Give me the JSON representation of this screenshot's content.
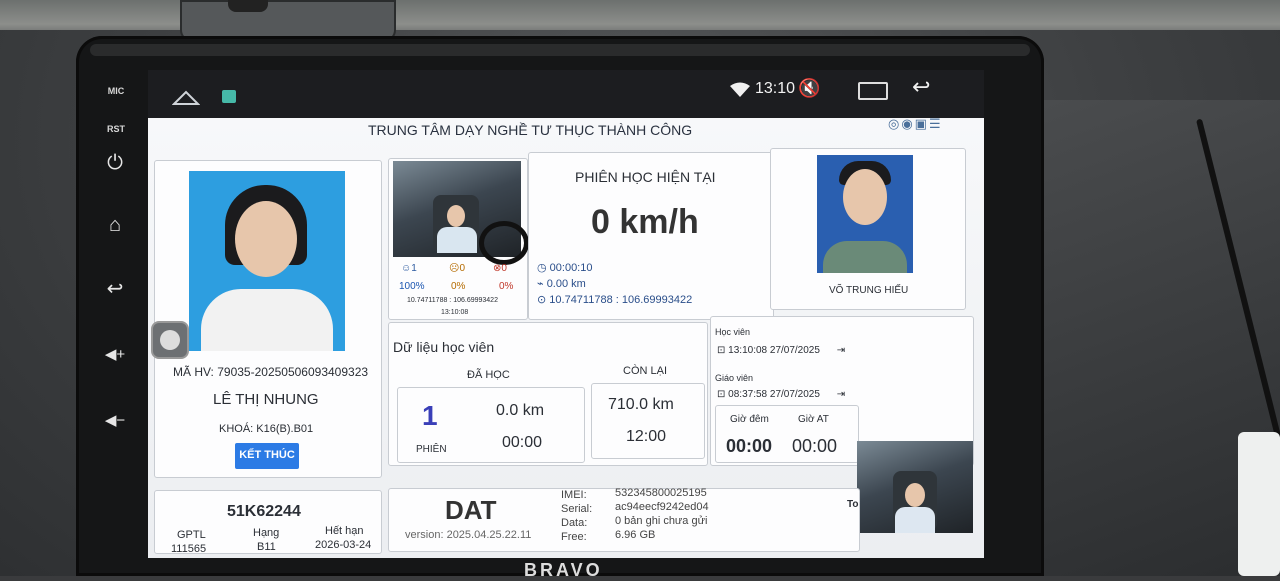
{
  "statusbar": {
    "time": "13:10",
    "icons": [
      "home-outline-icon",
      "app-thumb-icon",
      "wifi-icon",
      "mute-icon",
      "recents-icon",
      "back-icon"
    ]
  },
  "side_buttons": {
    "mic": "MIC",
    "rst": "RST"
  },
  "center_name": "TRUNG TÂM DẠY NGHỀ TƯ THỤC THÀNH CÔNG",
  "student": {
    "id": "MÃ HV: 79035-20250506093409323",
    "name": "LÊ THỊ NHUNG",
    "course": "KHOÁ: K16(B).B01",
    "end_button": "KẾT THÚC"
  },
  "camera": {
    "stat1_value": "1",
    "stat2_value": "0",
    "stat3_value": "0",
    "stat1_pct": "100%",
    "stat2_pct": "0%",
    "stat3_pct": "0%",
    "coords": "10.74711788 : 106.69993422",
    "time": "13:10:08"
  },
  "session": {
    "title": "PHIÊN HỌC HIỆN TẠI",
    "speed": "0 km/h",
    "duration": "00:00:10",
    "distance": "0.00 km",
    "coords": "10.74711788 : 106.69993422"
  },
  "teacher": {
    "name": "VÕ TRUNG HIẾU"
  },
  "student_data": {
    "title": "Dữ liệu học viên",
    "learned_label": "ĐÃ HỌC",
    "remain_label": "CÒN LẠI",
    "sessions": "1",
    "sessions_label": "PHIÊN",
    "learned_km": "0.0 km",
    "learned_time": "00:00",
    "remain_km": "710.0 km",
    "remain_time": "12:00"
  },
  "login": {
    "student_label": "Học viên",
    "student_time": "13:10:08 27/07/2025",
    "teacher_label": "Giáo viên",
    "teacher_time": "08:37:58 27/07/2025",
    "night_label": "Giờ đêm",
    "night_value": "00:00",
    "auto_label": "Giờ AT",
    "auto_value": "00:00"
  },
  "vehicle": {
    "plate": "51K62244",
    "gptl_label": "GPTL",
    "gptl_value": "111565",
    "rank_label": "Hạng",
    "rank_value": "B11",
    "expire_label": "Hết hạn",
    "expire_value": "2026-03-24"
  },
  "device": {
    "name": "DAT",
    "version": "version: 2025.04.25.22.11",
    "imei_label": "IMEI:",
    "imei_value": "532345800025195",
    "serial_label": "Serial:",
    "serial_value": "ac94eecf9242ed04",
    "data_label": "Data:",
    "data_value": "0 bản ghi chưa gửi",
    "free_label": "Free:",
    "free_value": "6.96 GB",
    "truncated": "To"
  },
  "brand": "BRAVO"
}
